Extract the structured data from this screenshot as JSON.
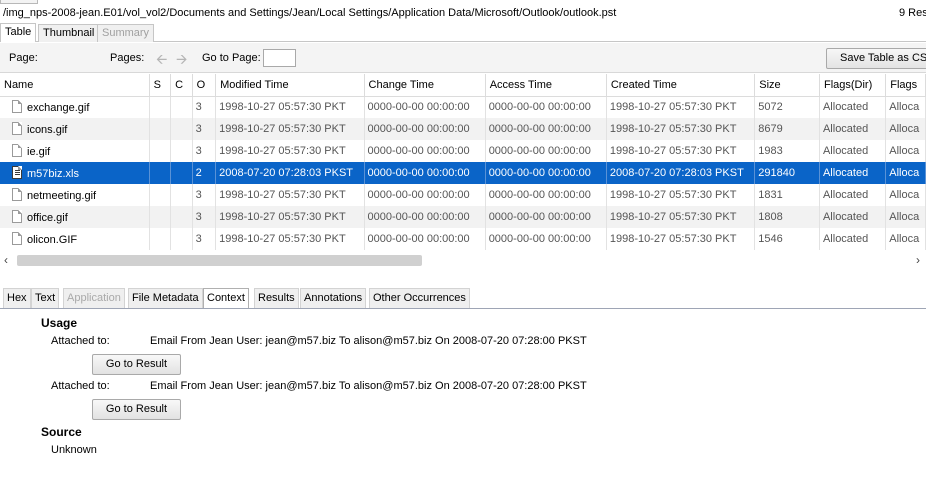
{
  "path_bar": {
    "path": "/img_nps-2008-jean.E01/vol_vol2/Documents and Settings/Jean/Local Settings/Application Data/Microsoft/Outlook/outlook.pst",
    "results_count": "9  Res"
  },
  "view_tabs": [
    {
      "label": "Table",
      "state": "active"
    },
    {
      "label": "Thumbnail",
      "state": "normal"
    },
    {
      "label": "Summary",
      "state": "disabled"
    }
  ],
  "paging": {
    "page_label": "Page:",
    "pages_label": "Pages:",
    "prev_icon": "left-arrow-icon",
    "next_icon": "right-arrow-icon",
    "goto_label": "Go to Page:",
    "goto_value": "",
    "save_button": "Save Table as CSV"
  },
  "table": {
    "columns": [
      "Name",
      "S",
      "C",
      "O",
      "Modified Time",
      "Change Time",
      "Access Time",
      "Created Time",
      "Size",
      "Flags(Dir)",
      "Flags"
    ],
    "rows": [
      {
        "name": "exchange.gif",
        "icon": "file-icon",
        "s": "",
        "c": "",
        "o": "3",
        "modified": "1998-10-27 05:57:30 PKT",
        "change": "0000-00-00 00:00:00",
        "access": "0000-00-00 00:00:00",
        "created": "1998-10-27 05:57:30 PKT",
        "size": "5072",
        "flags_dir": "Allocated",
        "flags": "Alloca"
      },
      {
        "name": "icons.gif",
        "icon": "file-icon",
        "s": "",
        "c": "",
        "o": "3",
        "modified": "1998-10-27 05:57:30 PKT",
        "change": "0000-00-00 00:00:00",
        "access": "0000-00-00 00:00:00",
        "created": "1998-10-27 05:57:30 PKT",
        "size": "8679",
        "flags_dir": "Allocated",
        "flags": "Alloca"
      },
      {
        "name": "ie.gif",
        "icon": "file-icon",
        "s": "",
        "c": "",
        "o": "3",
        "modified": "1998-10-27 05:57:30 PKT",
        "change": "0000-00-00 00:00:00",
        "access": "0000-00-00 00:00:00",
        "created": "1998-10-27 05:57:30 PKT",
        "size": "1983",
        "flags_dir": "Allocated",
        "flags": "Alloca"
      },
      {
        "name": "m57biz.xls",
        "icon": "spreadsheet-icon",
        "s": "",
        "c": "",
        "o": "2",
        "modified": "2008-07-20 07:28:03 PKST",
        "change": "0000-00-00 00:00:00",
        "access": "0000-00-00 00:00:00",
        "created": "2008-07-20 07:28:03 PKST",
        "size": "291840",
        "flags_dir": "Allocated",
        "flags": "Alloca",
        "selected": true
      },
      {
        "name": "netmeeting.gif",
        "icon": "file-icon",
        "s": "",
        "c": "",
        "o": "3",
        "modified": "1998-10-27 05:57:30 PKT",
        "change": "0000-00-00 00:00:00",
        "access": "0000-00-00 00:00:00",
        "created": "1998-10-27 05:57:30 PKT",
        "size": "1831",
        "flags_dir": "Allocated",
        "flags": "Alloca"
      },
      {
        "name": "office.gif",
        "icon": "file-icon",
        "s": "",
        "c": "",
        "o": "3",
        "modified": "1998-10-27 05:57:30 PKT",
        "change": "0000-00-00 00:00:00",
        "access": "0000-00-00 00:00:00",
        "created": "1998-10-27 05:57:30 PKT",
        "size": "1808",
        "flags_dir": "Allocated",
        "flags": "Alloca"
      },
      {
        "name": "olicon.GIF",
        "icon": "file-icon",
        "s": "",
        "c": "",
        "o": "3",
        "modified": "1998-10-27 05:57:30 PKT",
        "change": "0000-00-00 00:00:00",
        "access": "0000-00-00 00:00:00",
        "created": "1998-10-27 05:57:30 PKT",
        "size": "1546",
        "flags_dir": "Allocated",
        "flags": "Alloca"
      }
    ]
  },
  "detail_tabs": [
    {
      "label": "Hex",
      "state": "normal"
    },
    {
      "label": "Text",
      "state": "normal"
    },
    {
      "label": "Application",
      "state": "disabled"
    },
    {
      "label": "File Metadata",
      "state": "normal"
    },
    {
      "label": "Context",
      "state": "active"
    },
    {
      "label": "Results",
      "state": "normal"
    },
    {
      "label": "Annotations",
      "state": "normal"
    },
    {
      "label": "Other Occurrences",
      "state": "normal"
    }
  ],
  "context": {
    "usage_heading": "Usage",
    "entries": [
      {
        "label": "Attached to:",
        "value": "Email From Jean User: jean@m57.biz To alison@m57.biz On 2008-07-20 07:28:00 PKST",
        "button": "Go to Result"
      },
      {
        "label": "Attached to:",
        "value": "Email From Jean User: jean@m57.biz To alison@m57.biz On 2008-07-20 07:28:00 PKST",
        "button": "Go to Result"
      }
    ],
    "source_heading": "Source",
    "source_value": "Unknown"
  },
  "colors": {
    "selection": "#0a64c8",
    "alt_row": "#f2f2f2"
  }
}
